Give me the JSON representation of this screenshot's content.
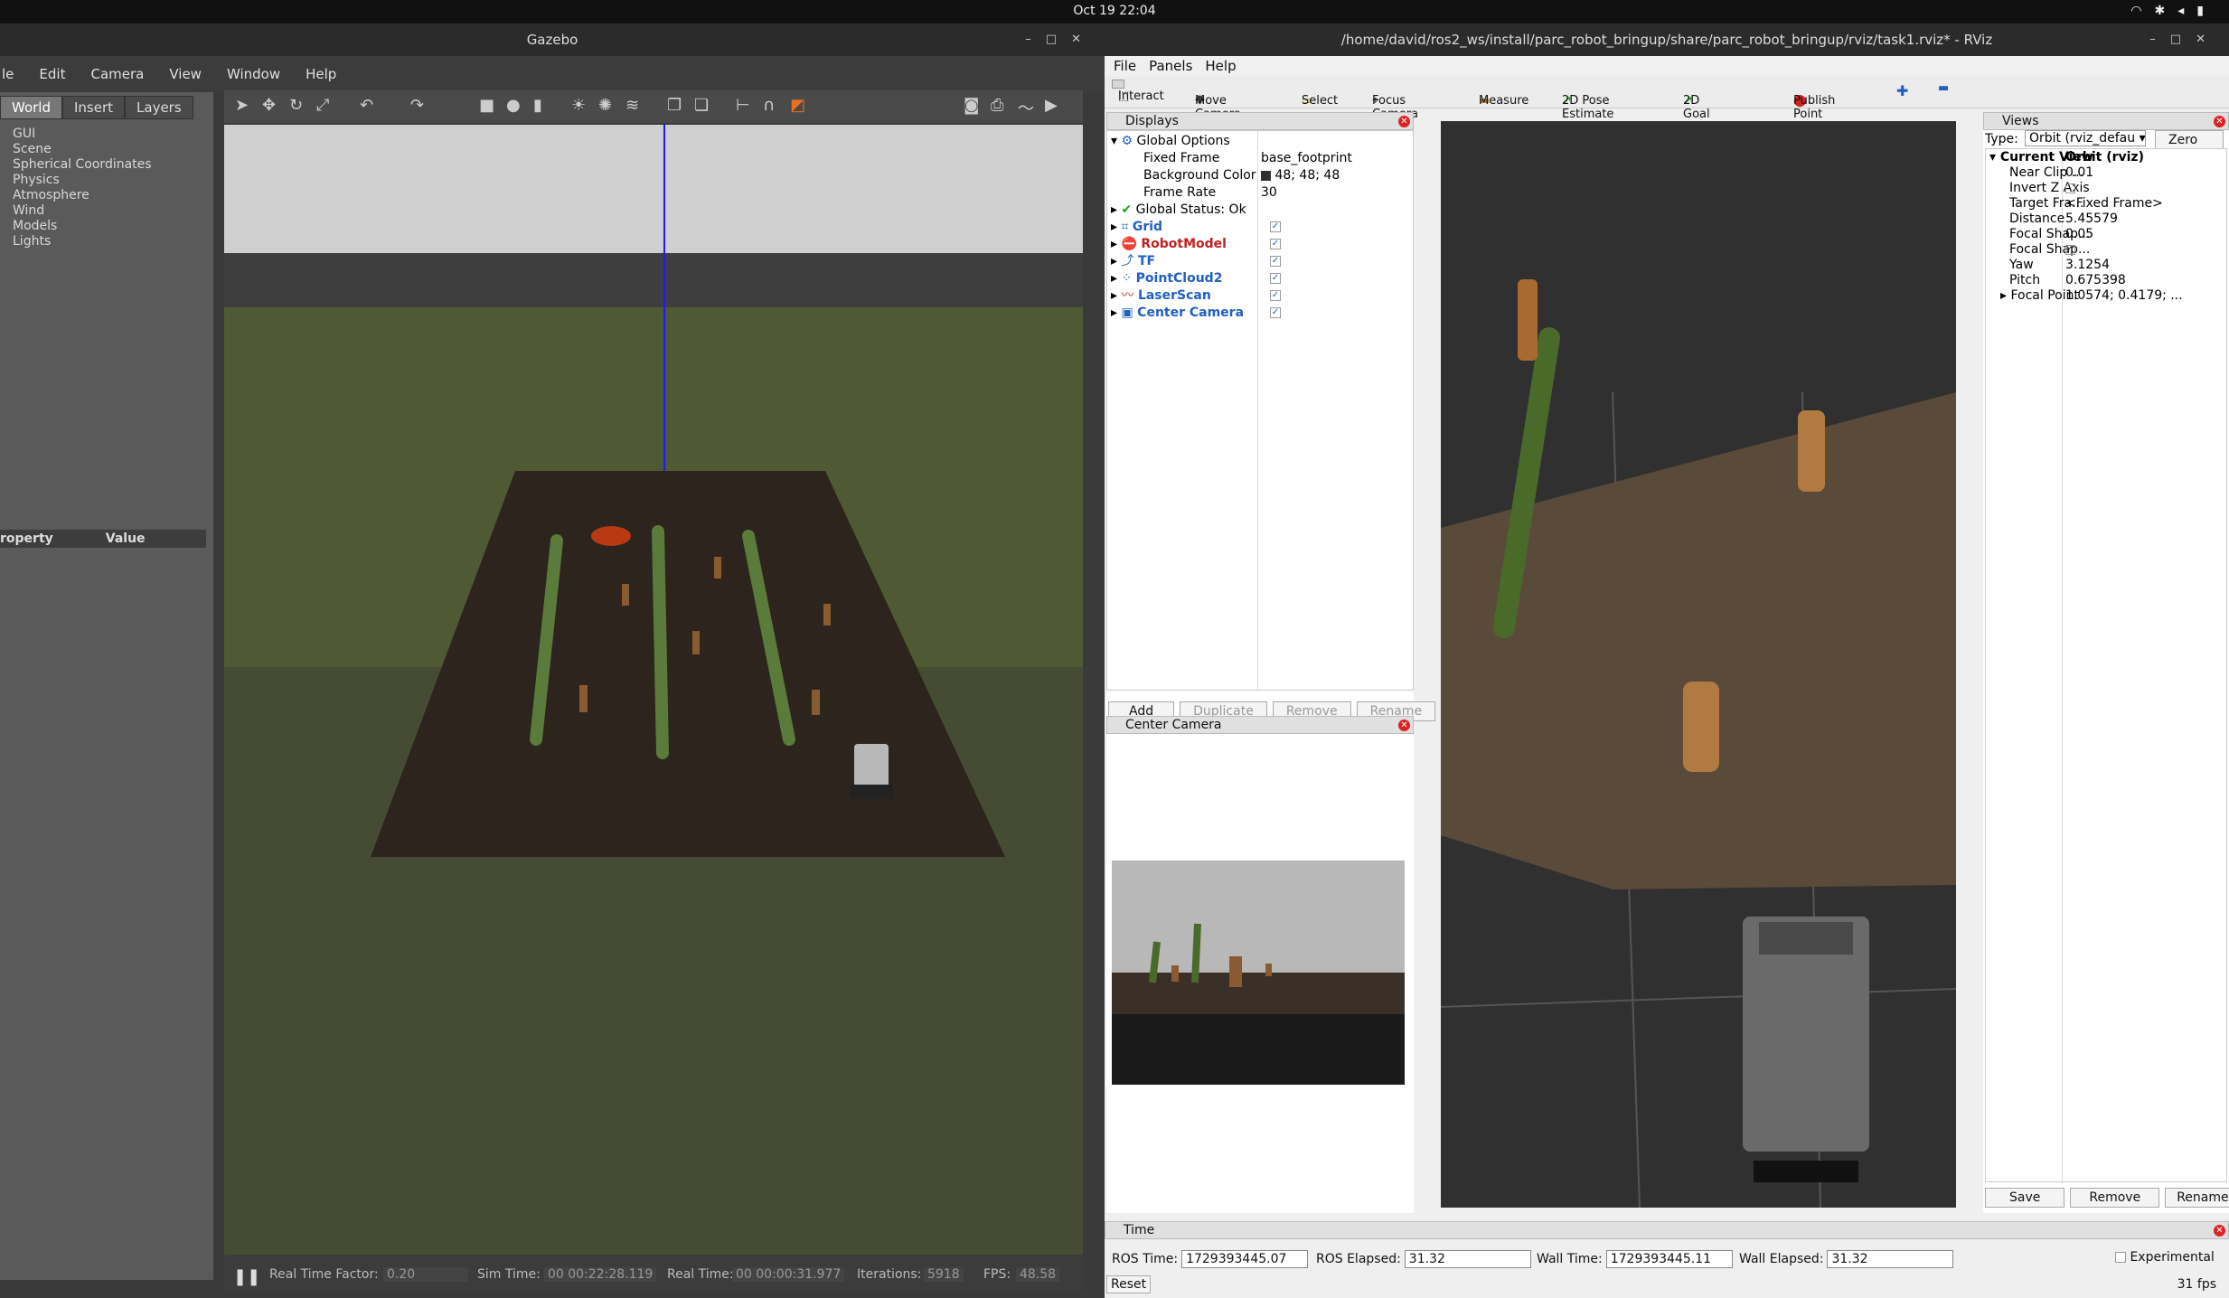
{
  "system": {
    "clock": "Oct 19  22:04"
  },
  "gazebo": {
    "title": "Gazebo",
    "menu": [
      "le",
      "Edit",
      "Camera",
      "View",
      "Window",
      "Help"
    ],
    "tabs": [
      "World",
      "Insert",
      "Layers"
    ],
    "tree": [
      "GUI",
      "Scene",
      "Spherical Coordinates",
      "Physics",
      "Atmosphere",
      "Wind",
      "Models",
      "Lights"
    ],
    "prop_header": {
      "property": "roperty",
      "value": "Value"
    },
    "status": {
      "rtf_label": "Real Time Factor:",
      "rtf": "0.20",
      "sim_label": "Sim Time:",
      "sim": "00 00:22:28.119",
      "real_label": "Real Time:",
      "real": "00 00:00:31.977",
      "iter_label": "Iterations:",
      "iter": "5918",
      "fps_label": "FPS:",
      "fps": "48.58"
    }
  },
  "rviz": {
    "title": "/home/david/ros2_ws/install/parc_robot_bringup/share/parc_robot_bringup/rviz/task1.rviz* - RViz",
    "menu": [
      "File",
      "Panels",
      "Help"
    ],
    "tools": [
      "Interact",
      "Move Camera",
      "Select",
      "Focus Camera",
      "Measure",
      "2D Pose Estimate",
      "2D Goal Pose",
      "Publish Point"
    ],
    "displays": {
      "title": "Displays",
      "global_options": "Global Options",
      "fixed_frame_label": "Fixed Frame",
      "fixed_frame": "base_footprint",
      "bg_label": "Background Color",
      "bg": "48; 48; 48",
      "rate_label": "Frame Rate",
      "rate": "30",
      "status": "Global Status: Ok",
      "items": [
        "Grid",
        "RobotModel",
        "TF",
        "PointCloud2",
        "LaserScan",
        "Center Camera"
      ],
      "buttons": [
        "Add",
        "Duplicate",
        "Remove",
        "Rename"
      ]
    },
    "camera_panel": {
      "title": "Center Camera"
    },
    "views": {
      "title": "Views",
      "type_label": "Type:",
      "type": "Orbit (rviz_defau",
      "zero": "Zero",
      "current": "Current View",
      "current_val": "Orbit (rviz)",
      "props": [
        {
          "k": "Near Clip ...",
          "v": "0.01"
        },
        {
          "k": "Invert Z Axis",
          "v": ""
        },
        {
          "k": "Target Fra...",
          "v": "<Fixed Frame>"
        },
        {
          "k": "Distance",
          "v": "5.45579"
        },
        {
          "k": "Focal Shap...",
          "v": "0.05"
        },
        {
          "k": "Focal Shap...",
          "v": ""
        },
        {
          "k": "Yaw",
          "v": "3.1254"
        },
        {
          "k": "Pitch",
          "v": "0.675398"
        },
        {
          "k": "Focal Point",
          "v": "1.0574; 0.4179; ..."
        }
      ],
      "buttons": [
        "Save",
        "Remove",
        "Rename"
      ]
    },
    "time": {
      "title": "Time",
      "ros_time_label": "ROS Time:",
      "ros_time": "1729393445.07",
      "ros_elapsed_label": "ROS Elapsed:",
      "ros_elapsed": "31.32",
      "wall_time_label": "Wall Time:",
      "wall_time": "1729393445.11",
      "wall_elapsed_label": "Wall Elapsed:",
      "wall_elapsed": "31.32",
      "experimental": "Experimental",
      "reset": "Reset",
      "fps": "31 fps"
    }
  }
}
